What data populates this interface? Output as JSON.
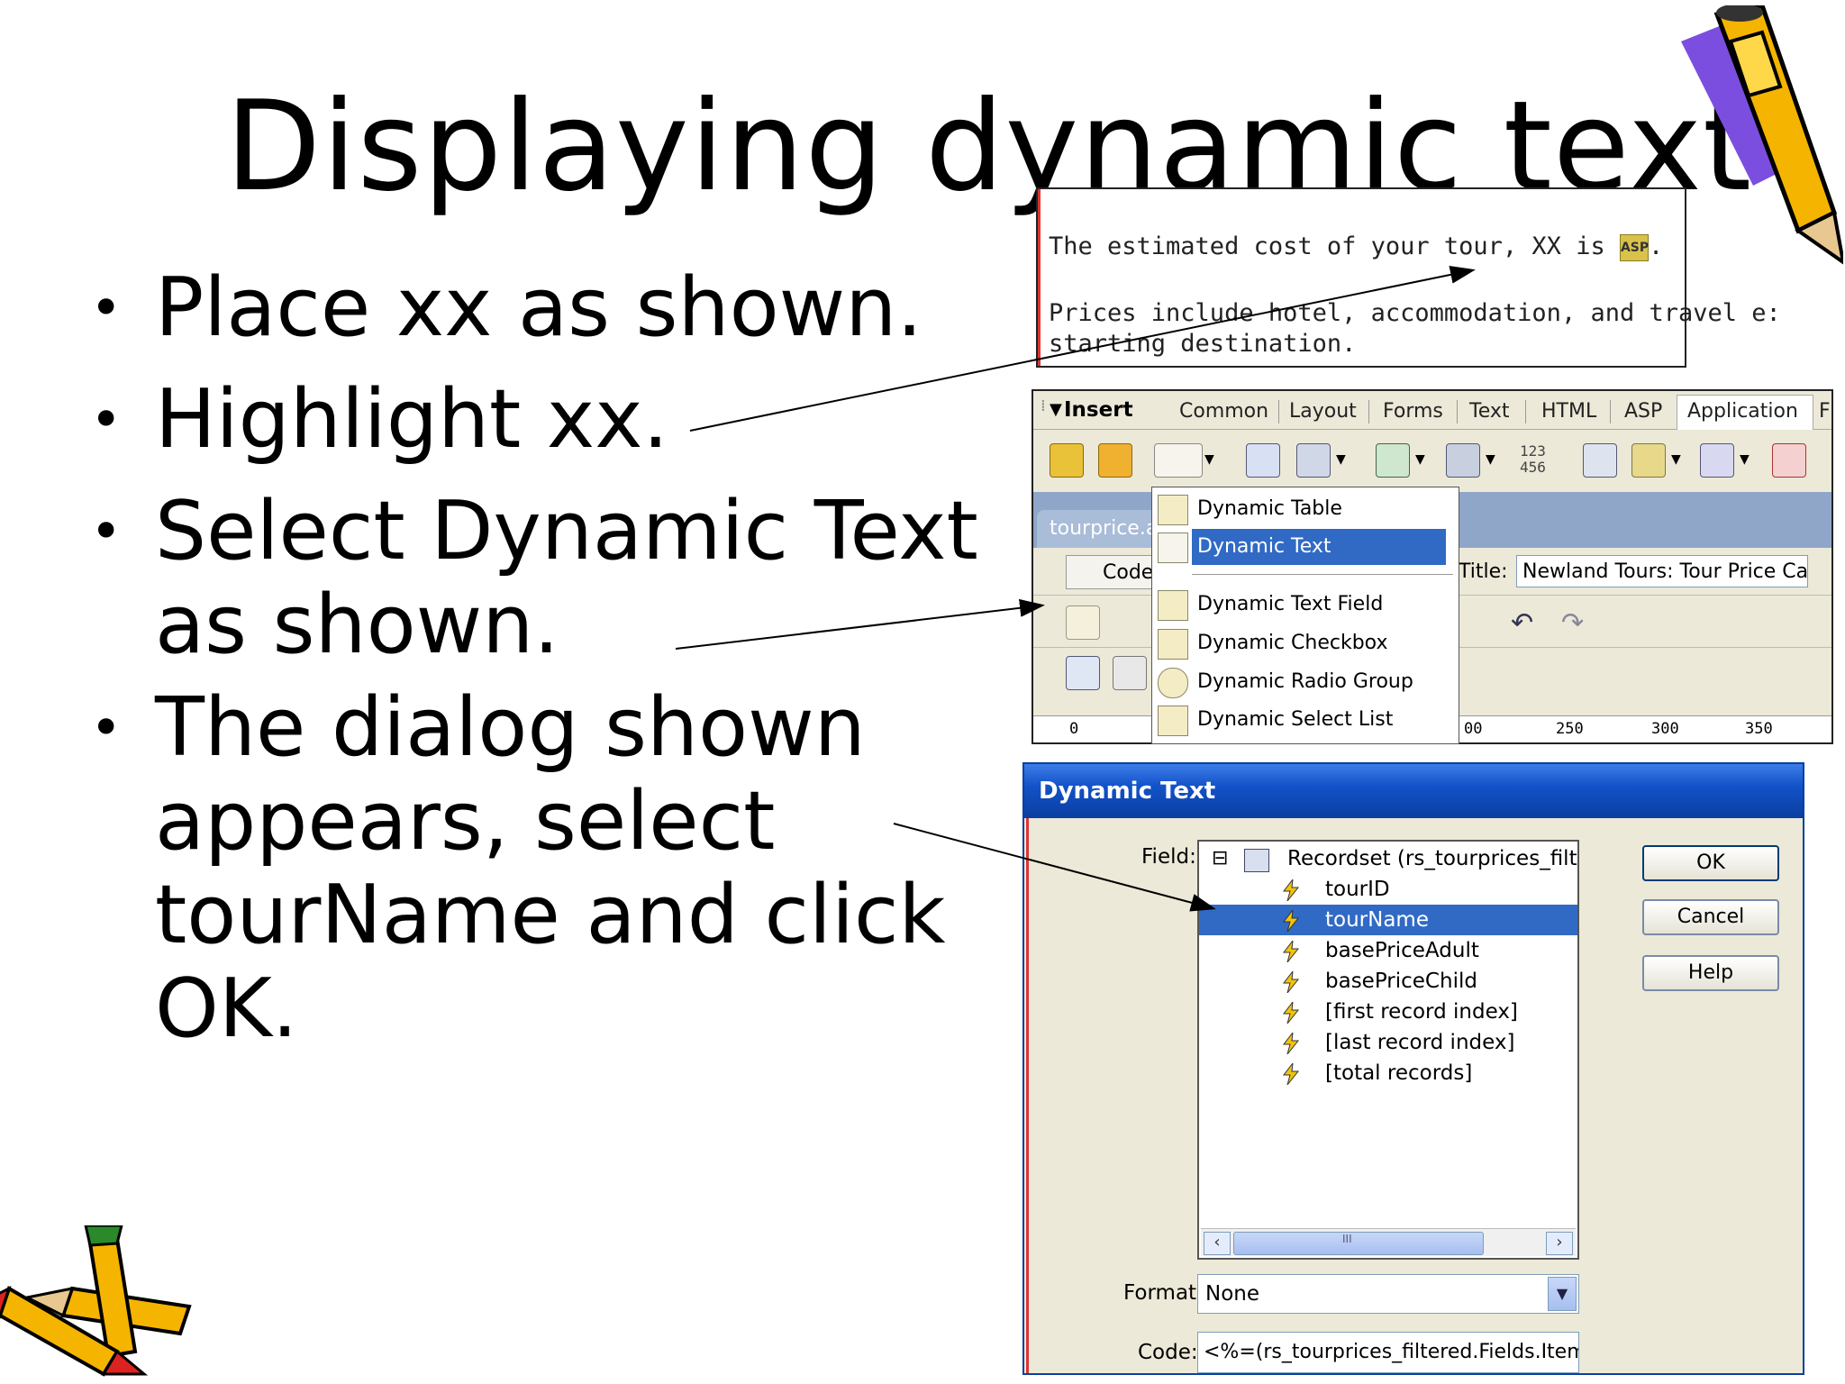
{
  "slide": {
    "title": "Displaying dynamic text",
    "bullets": [
      "Place xx as shown.",
      "Highlight xx.",
      "Select Dynamic Text\nas shown.",
      "The dialog shown\nappears, select\ntourName and click\nOK."
    ],
    "bullet_glyph": "•"
  },
  "snippet": {
    "line1_prefix": "The estimated cost of your tour, XX is ",
    "line1_suffix": ".",
    "asp_icon_text": "ASP",
    "line2": "Prices include hotel, accommodation, and travel e:",
    "line3": "starting destination."
  },
  "insert_bar": {
    "label": "Insert",
    "tabs": [
      "Common",
      "Layout",
      "Forms",
      "Text",
      "HTML",
      "ASP",
      "Application",
      "Fl"
    ],
    "active_tab": "Application",
    "numbers_icon": "123\n456"
  },
  "document": {
    "tab_label": "tourprice.a",
    "code_button": "Code",
    "title_label": "Title:",
    "title_value": "Newland Tours: Tour Price Cal"
  },
  "ruler": {
    "ticks": [
      "0",
      "00",
      "250",
      "300",
      "350"
    ]
  },
  "dynamic_menu": {
    "items": [
      "Dynamic Table",
      "Dynamic Text",
      "Dynamic Text Field",
      "Dynamic Checkbox",
      "Dynamic Radio Group",
      "Dynamic Select List"
    ],
    "selected": "Dynamic Text"
  },
  "dialog": {
    "title": "Dynamic Text",
    "field_label": "Field:",
    "recordset_label": "Recordset (rs_tourprices_filtere",
    "tree_toggle": "⊟",
    "fields": [
      "tourID",
      "tourName",
      "basePriceAdult",
      "basePriceChild",
      "[first record index]",
      "[last record index]",
      "[total records]"
    ],
    "selected_field": "tourName",
    "scroll_grip": "III",
    "format_label": "Format:",
    "format_value": "None",
    "code_label": "Code:",
    "code_value": "<%=(rs_tourprices_filtered.Fields.Item(\"to",
    "buttons": {
      "ok": "OK",
      "cancel": "Cancel",
      "help": "Help"
    }
  },
  "colors": {
    "selection": "#316ac5",
    "titlebar": "#0a3fa0",
    "window_bg": "#ece9d8",
    "doc_tab_strip": "#8fa6c8"
  }
}
